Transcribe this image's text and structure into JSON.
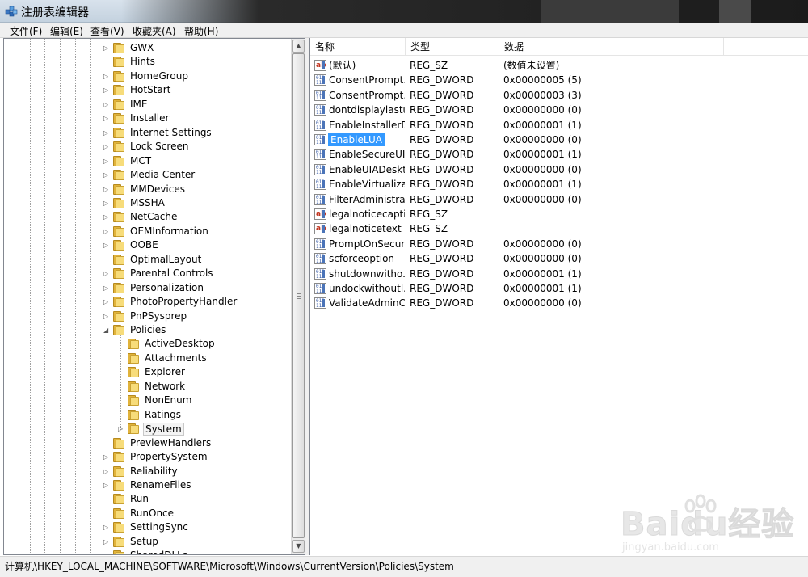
{
  "window": {
    "title": "注册表编辑器"
  },
  "menu": [
    "文件(F)",
    "编辑(E)",
    "查看(V)",
    "收藏夹(A)",
    "帮助(H)"
  ],
  "tree": {
    "nodes": [
      {
        "label": "GWX",
        "level": 0,
        "expander": "collapsed"
      },
      {
        "label": "Hints",
        "level": 0,
        "expander": "none"
      },
      {
        "label": "HomeGroup",
        "level": 0,
        "expander": "collapsed"
      },
      {
        "label": "HotStart",
        "level": 0,
        "expander": "collapsed"
      },
      {
        "label": "IME",
        "level": 0,
        "expander": "collapsed"
      },
      {
        "label": "Installer",
        "level": 0,
        "expander": "collapsed"
      },
      {
        "label": "Internet Settings",
        "level": 0,
        "expander": "collapsed"
      },
      {
        "label": "Lock Screen",
        "level": 0,
        "expander": "collapsed"
      },
      {
        "label": "MCT",
        "level": 0,
        "expander": "collapsed"
      },
      {
        "label": "Media Center",
        "level": 0,
        "expander": "collapsed"
      },
      {
        "label": "MMDevices",
        "level": 0,
        "expander": "collapsed"
      },
      {
        "label": "MSSHA",
        "level": 0,
        "expander": "collapsed"
      },
      {
        "label": "NetCache",
        "level": 0,
        "expander": "collapsed"
      },
      {
        "label": "OEMInformation",
        "level": 0,
        "expander": "collapsed"
      },
      {
        "label": "OOBE",
        "level": 0,
        "expander": "collapsed"
      },
      {
        "label": "OptimalLayout",
        "level": 0,
        "expander": "none"
      },
      {
        "label": "Parental Controls",
        "level": 0,
        "expander": "collapsed"
      },
      {
        "label": "Personalization",
        "level": 0,
        "expander": "collapsed"
      },
      {
        "label": "PhotoPropertyHandler",
        "level": 0,
        "expander": "collapsed"
      },
      {
        "label": "PnPSysprep",
        "level": 0,
        "expander": "collapsed"
      },
      {
        "label": "Policies",
        "level": 0,
        "expander": "expanded"
      },
      {
        "label": "ActiveDesktop",
        "level": 1,
        "expander": "none"
      },
      {
        "label": "Attachments",
        "level": 1,
        "expander": "none"
      },
      {
        "label": "Explorer",
        "level": 1,
        "expander": "none"
      },
      {
        "label": "Network",
        "level": 1,
        "expander": "none"
      },
      {
        "label": "NonEnum",
        "level": 1,
        "expander": "none"
      },
      {
        "label": "Ratings",
        "level": 1,
        "expander": "none"
      },
      {
        "label": "System",
        "level": 1,
        "expander": "collapsed",
        "selected": true
      },
      {
        "label": "PreviewHandlers",
        "level": 0,
        "expander": "none"
      },
      {
        "label": "PropertySystem",
        "level": 0,
        "expander": "collapsed"
      },
      {
        "label": "Reliability",
        "level": 0,
        "expander": "collapsed"
      },
      {
        "label": "RenameFiles",
        "level": 0,
        "expander": "collapsed"
      },
      {
        "label": "Run",
        "level": 0,
        "expander": "none"
      },
      {
        "label": "RunOnce",
        "level": 0,
        "expander": "none"
      },
      {
        "label": "SettingSync",
        "level": 0,
        "expander": "collapsed"
      },
      {
        "label": "Setup",
        "level": 0,
        "expander": "collapsed"
      },
      {
        "label": "SharedDLLs",
        "level": 0,
        "expander": "none"
      }
    ]
  },
  "list": {
    "columns": [
      "名称",
      "类型",
      "数据"
    ],
    "rows": [
      {
        "icon": "string-value-icon",
        "name": "(默认)",
        "type": "REG_SZ",
        "data": "(数值未设置)"
      },
      {
        "icon": "dword-value-icon",
        "name": "ConsentPrompt...",
        "type": "REG_DWORD",
        "data": "0x00000005 (5)"
      },
      {
        "icon": "dword-value-icon",
        "name": "ConsentPrompt...",
        "type": "REG_DWORD",
        "data": "0x00000003 (3)"
      },
      {
        "icon": "dword-value-icon",
        "name": "dontdisplaylastu...",
        "type": "REG_DWORD",
        "data": "0x00000000 (0)"
      },
      {
        "icon": "dword-value-icon",
        "name": "EnableInstallerD...",
        "type": "REG_DWORD",
        "data": "0x00000001 (1)"
      },
      {
        "icon": "dword-value-icon",
        "name": "EnableLUA",
        "type": "REG_DWORD",
        "data": "0x00000000 (0)",
        "selected": true
      },
      {
        "icon": "dword-value-icon",
        "name": "EnableSecureUI...",
        "type": "REG_DWORD",
        "data": "0x00000001 (1)"
      },
      {
        "icon": "dword-value-icon",
        "name": "EnableUIADeskt...",
        "type": "REG_DWORD",
        "data": "0x00000000 (0)"
      },
      {
        "icon": "dword-value-icon",
        "name": "EnableVirtualizat...",
        "type": "REG_DWORD",
        "data": "0x00000001 (1)"
      },
      {
        "icon": "dword-value-icon",
        "name": "FilterAdministra...",
        "type": "REG_DWORD",
        "data": "0x00000000 (0)"
      },
      {
        "icon": "string-value-icon",
        "name": "legalnoticecapti...",
        "type": "REG_SZ",
        "data": ""
      },
      {
        "icon": "string-value-icon",
        "name": "legalnoticetext",
        "type": "REG_SZ",
        "data": ""
      },
      {
        "icon": "dword-value-icon",
        "name": "PromptOnSecur...",
        "type": "REG_DWORD",
        "data": "0x00000000 (0)"
      },
      {
        "icon": "dword-value-icon",
        "name": "scforceoption",
        "type": "REG_DWORD",
        "data": "0x00000000 (0)"
      },
      {
        "icon": "dword-value-icon",
        "name": "shutdownwitho...",
        "type": "REG_DWORD",
        "data": "0x00000001 (1)"
      },
      {
        "icon": "dword-value-icon",
        "name": "undockwithoutl...",
        "type": "REG_DWORD",
        "data": "0x00000001 (1)"
      },
      {
        "icon": "dword-value-icon",
        "name": "ValidateAdminC...",
        "type": "REG_DWORD",
        "data": "0x00000000 (0)"
      }
    ]
  },
  "status": {
    "path": "计算机\\HKEY_LOCAL_MACHINE\\SOFTWARE\\Microsoft\\Windows\\CurrentVersion\\Policies\\System"
  },
  "watermark": {
    "brand": "Baidu经验",
    "url": "jingyan.baidu.com"
  },
  "colors": {
    "selection": "#3399ff",
    "folder": "#f7dc7a",
    "dword_icon": "#3156a5",
    "string_icon": "#c2341f"
  }
}
